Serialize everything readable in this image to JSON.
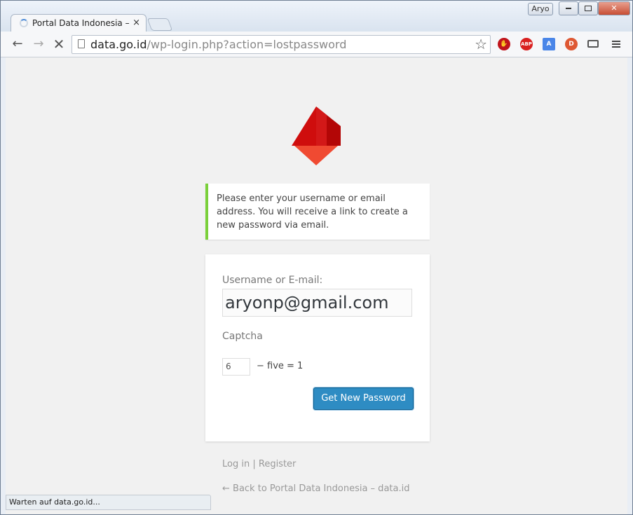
{
  "window": {
    "profile_name": "Aryo",
    "min_label": "▭",
    "max_label": "▢",
    "close_label": "✕"
  },
  "tab": {
    "title": "Portal Data Indonesia – da",
    "close_label": "×"
  },
  "toolbar": {
    "back_icon": "back-arrow-icon",
    "forward_icon": "forward-arrow-icon",
    "stop_icon": "stop-icon",
    "url_host": "data.go.id",
    "url_rest": "/wp-login.php?action=lostpassword",
    "star_icon": "star-icon",
    "extensions": [
      {
        "name": "ublock-icon",
        "label": "✋",
        "color": "#c0141b"
      },
      {
        "name": "adblock-plus-icon",
        "label": "ABP",
        "color": "#d92020"
      },
      {
        "name": "translate-icon",
        "label": "A",
        "color": "#4a86e8"
      },
      {
        "name": "duckduckgo-icon",
        "label": "D",
        "color": "#de5833"
      },
      {
        "name": "cast-icon",
        "label": "",
        "color": "#555555"
      },
      {
        "name": "menu-icon",
        "label": "",
        "color": "#555555"
      }
    ]
  },
  "page": {
    "message": "Please enter your username or email address. You will receive a link to create a new password via email.",
    "message_color": "#7ad03a",
    "username_label": "Username or E-mail:",
    "username_value": "aryonp@gmail.com",
    "captcha_label": "Captcha",
    "captcha_value": "6",
    "captcha_equation": "− five = 1",
    "submit_label": "Get New Password",
    "login_link": "Log in",
    "separator": "|",
    "register_link": "Register",
    "back_link": "← Back to Portal Data Indonesia – data.id",
    "accent_color": "#2e8cc3"
  },
  "status": {
    "text": "Warten auf data.go.id..."
  }
}
